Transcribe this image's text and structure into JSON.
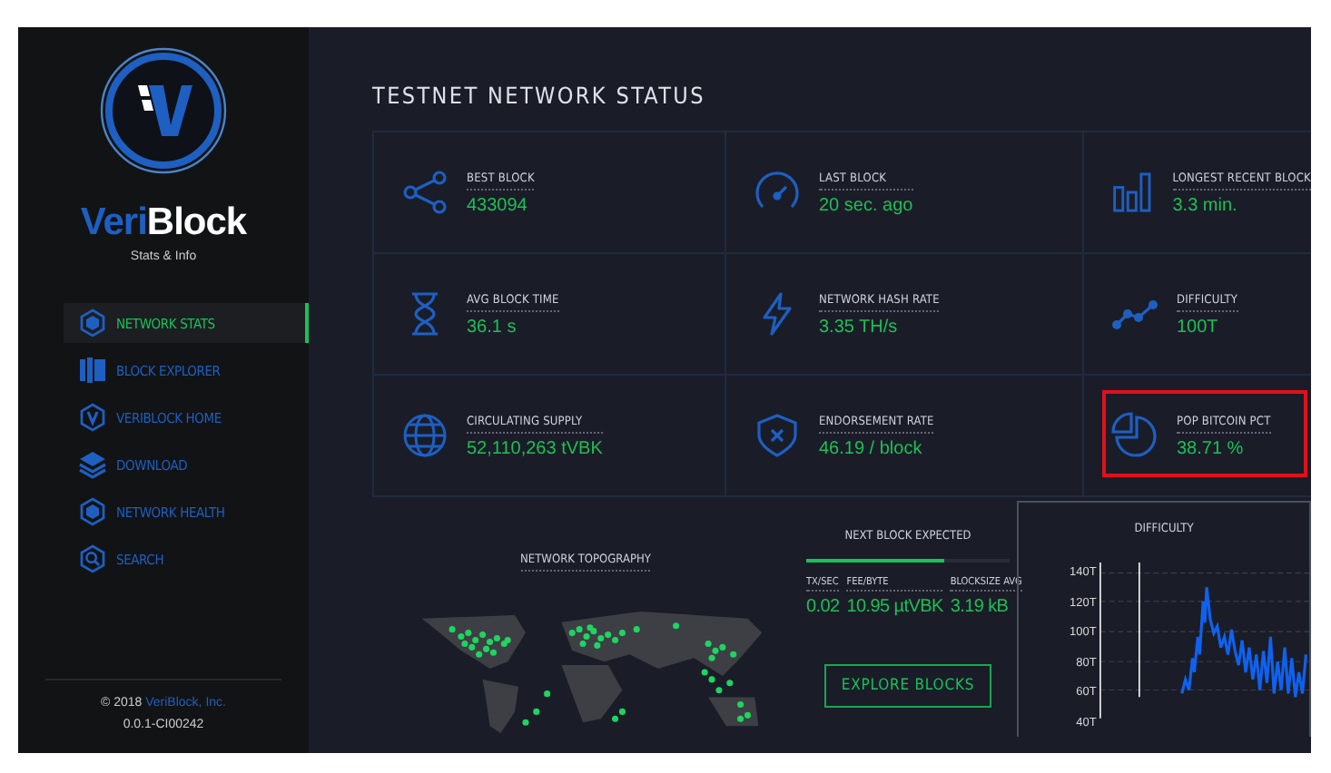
{
  "sidebar": {
    "logo_text": {
      "part_1": "Veri",
      "part_2": "Block"
    },
    "subtitle": "Stats & Info",
    "nav": [
      {
        "label": "NETWORK STATS",
        "selected": true
      },
      {
        "label": "BLOCK EXPLORER",
        "selected": false
      },
      {
        "label": "VERIBLOCK HOME",
        "selected": false
      },
      {
        "label": "DOWNLOAD",
        "selected": false
      },
      {
        "label": "NETWORK HEALTH",
        "selected": false
      },
      {
        "label": "SEARCH",
        "selected": false
      }
    ],
    "footer": {
      "copyright": "© 2018",
      "company_link": "VeriBlock, Inc.",
      "version": "0.0.1-CI00242"
    }
  },
  "page_title": "TESTNET NETWORK STATUS",
  "stats": [
    {
      "kind": "share",
      "label": "BEST BLOCK",
      "value": "433094",
      "highlighted": false
    },
    {
      "kind": "gauge",
      "label": "LAST BLOCK",
      "value": "20 sec. ago",
      "highlighted": false
    },
    {
      "kind": "bars",
      "label": "LONGEST RECENT BLOCK",
      "value": "3.3 min.",
      "highlighted": false
    },
    {
      "kind": "hourglass",
      "label": "AVG BLOCK TIME",
      "value": "36.1 s",
      "highlighted": false
    },
    {
      "kind": "bolt",
      "label": "NETWORK HASH RATE",
      "value": "3.35 TH/s",
      "highlighted": false
    },
    {
      "kind": "trend",
      "label": "DIFFICULTY",
      "value": "100T",
      "highlighted": false
    },
    {
      "kind": "globe",
      "label": "CIRCULATING SUPPLY",
      "value": "52,110,263 tVBK",
      "highlighted": false
    },
    {
      "kind": "shield",
      "label": "ENDORSEMENT RATE",
      "value": "46.19 / block",
      "highlighted": false
    },
    {
      "kind": "pie",
      "label": "POP BITCOIN PCT",
      "value": "38.71 %",
      "highlighted": true
    }
  ],
  "topography": {
    "title": "NETWORK TOPOGRAPHY"
  },
  "next_block": {
    "title": "NEXT BLOCK EXPECTED",
    "level": 0.68,
    "metrics": [
      {
        "label": "TX/SEC",
        "value": "0.02"
      },
      {
        "label": "FEE/BYTE",
        "value": "10.95 µtVBK"
      },
      {
        "label": "BLOCKSIZE AVG",
        "value": "3.19 kB"
      }
    ],
    "button": "EXPLORE BLOCKS"
  },
  "difficulty_panel": {
    "title": "DIFFICULTY",
    "y_tick_labels": [
      "140T",
      "120T",
      "100T",
      "80T",
      "60T",
      "40T"
    ]
  }
}
